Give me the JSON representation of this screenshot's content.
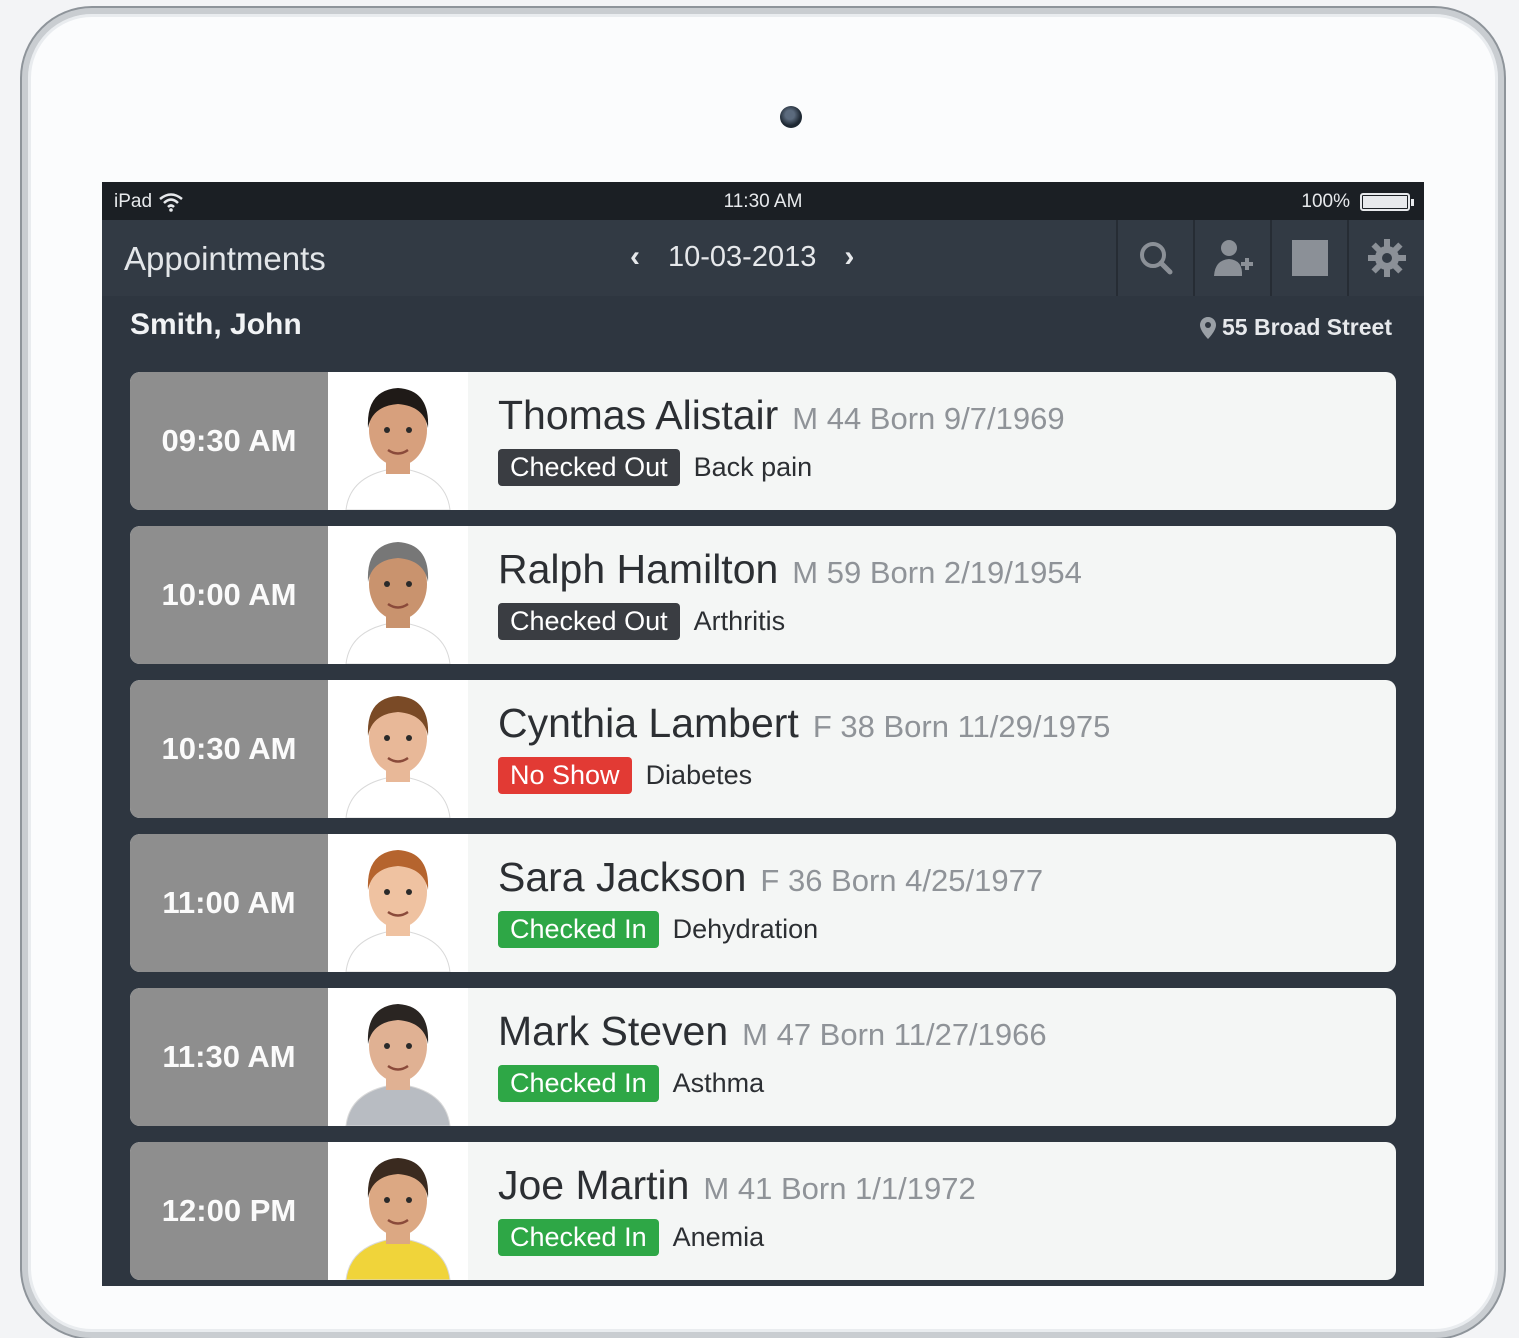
{
  "statusbar": {
    "device": "iPad",
    "time": "11:30 AM",
    "battery": "100%"
  },
  "header": {
    "title": "Appointments",
    "date": "10-03-2013"
  },
  "toolbar": [
    "search-icon",
    "add-user-icon",
    "calendar-icon",
    "gear-icon"
  ],
  "provider": {
    "name": "Smith, John",
    "location": "55 Broad Street"
  },
  "colors": {
    "checked_out": "#3a3d42",
    "no_show": "#e23a34",
    "checked_in": "#2ea746",
    "time_bg": "#8e8e8e"
  },
  "appointments": [
    {
      "time": "09:30 AM",
      "name": "Thomas Alistair",
      "demo": "M 44 Born 9/7/1969",
      "status": "Checked Out",
      "status_type": "checked_out",
      "reason": "Back pain",
      "photo": {
        "skin": "#d7a07d",
        "hair": "#1f1a17",
        "shirt": "#ffffff"
      }
    },
    {
      "time": "10:00 AM",
      "name": "Ralph Hamilton",
      "demo": "M 59 Born 2/19/1954",
      "status": "Checked Out",
      "status_type": "checked_out",
      "reason": "Arthritis",
      "photo": {
        "skin": "#c9936e",
        "hair": "#777777",
        "shirt": "#ffffff"
      }
    },
    {
      "time": "10:30 AM",
      "name": "Cynthia Lambert",
      "demo": "F 38 Born 11/29/1975",
      "status": "No Show",
      "status_type": "no_show",
      "reason": "Diabetes",
      "photo": {
        "skin": "#e8b898",
        "hair": "#7a4a26",
        "shirt": "#ffffff"
      }
    },
    {
      "time": "11:00 AM",
      "name": "Sara Jackson",
      "demo": "F 36 Born 4/25/1977",
      "status": "Checked In",
      "status_type": "checked_in",
      "reason": "Dehydration",
      "photo": {
        "skin": "#efc2a1",
        "hair": "#b5642e",
        "shirt": "#ffffff"
      }
    },
    {
      "time": "11:30 AM",
      "name": "Mark Steven",
      "demo": "M 47 Born 11/27/1966",
      "status": "Checked In",
      "status_type": "checked_in",
      "reason": "Asthma",
      "photo": {
        "skin": "#e0b193",
        "hair": "#2a2522",
        "shirt": "#b8bcc2"
      }
    },
    {
      "time": "12:00 PM",
      "name": "Joe Martin",
      "demo": "M 41 Born 1/1/1972",
      "status": "Checked In",
      "status_type": "checked_in",
      "reason": "Anemia",
      "photo": {
        "skin": "#dca883",
        "hair": "#3a2a1f",
        "shirt": "#f0d43a"
      }
    }
  ]
}
